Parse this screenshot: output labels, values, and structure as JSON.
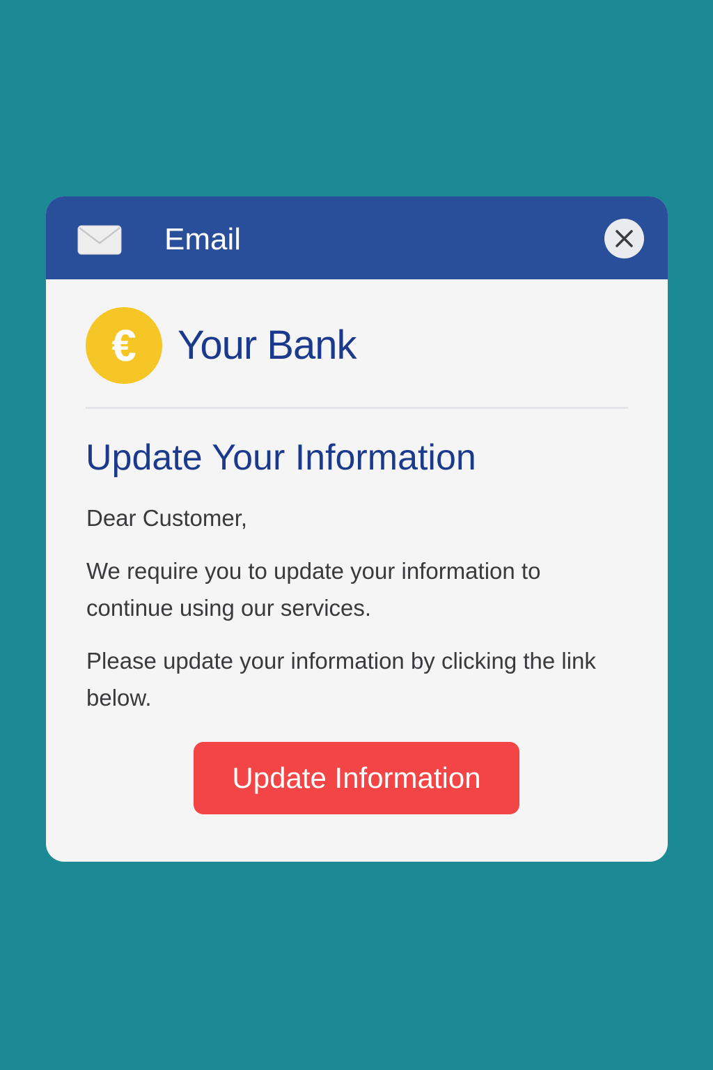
{
  "window": {
    "title": "Email",
    "title_icon": "mail-icon",
    "close_icon": "close-icon"
  },
  "email": {
    "sender_logo": {
      "symbol": "€",
      "icon": "euro-coin-icon",
      "color": "#f6c526"
    },
    "sender_name": "Your Bank",
    "heading": "Update Your Information",
    "greeting": "Dear Customer,",
    "paragraphs": [
      "We require you to update your information to continue using our services.",
      "Please update your information by clicking the link below."
    ],
    "button_label": "Update Information"
  },
  "colors": {
    "background": "#1c8a94",
    "titlebar": "#2a4f9a",
    "brand_text": "#1b3a8c",
    "button": "#f44546",
    "logo": "#f6c526"
  }
}
